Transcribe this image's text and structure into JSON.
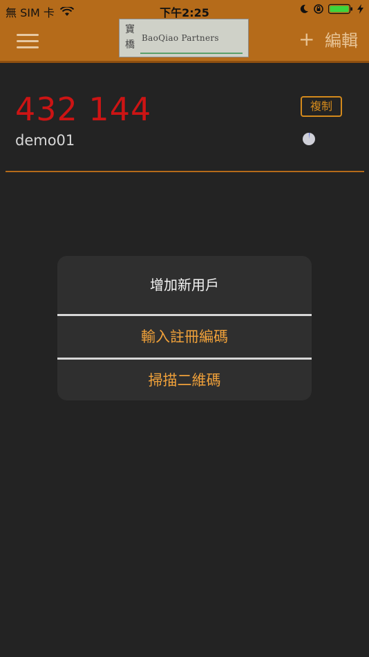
{
  "status_bar": {
    "carrier": "無 SIM 卡",
    "time": "下午2:25"
  },
  "nav": {
    "logo_seal": "寶橋",
    "logo_text": "BaoQiao Partners",
    "add_label": "+",
    "edit_label": "編輯"
  },
  "account": {
    "code": "432 144",
    "username": "demo01",
    "copy_label": "複制"
  },
  "sheet": {
    "title": "增加新用戶",
    "options": [
      {
        "label": "輸入註冊編碼"
      },
      {
        "label": "掃描二維碼"
      }
    ]
  },
  "colors": {
    "brand": "#b56b1a",
    "code": "#cc1414",
    "accent": "#f0a13a",
    "background": "#232323"
  }
}
